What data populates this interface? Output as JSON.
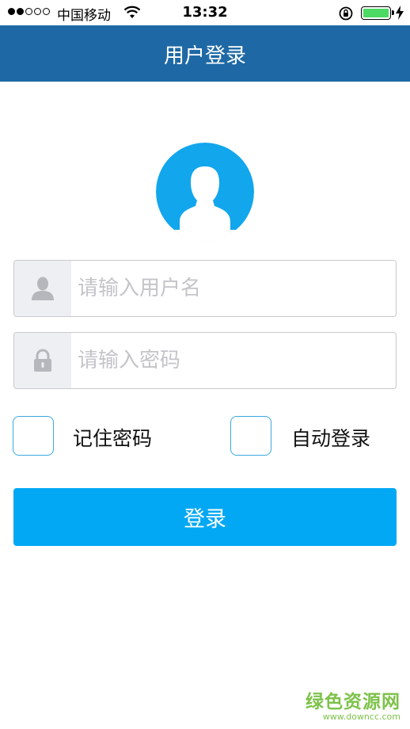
{
  "status_bar": {
    "carrier": "中国移动",
    "time": "13:32",
    "signal_bars_filled": 2,
    "signal_bars_total": 5,
    "battery_level": 1.0,
    "battery_color": "#4cd964"
  },
  "nav": {
    "title": "用户登录",
    "background_color": "#1e69a5"
  },
  "avatar": {
    "icon": "user-avatar-icon",
    "color": "#12a6ed"
  },
  "form": {
    "username": {
      "placeholder": "请输入用户名",
      "value": "",
      "icon": "user-icon"
    },
    "password": {
      "placeholder": "请输入密码",
      "value": "",
      "icon": "lock-icon"
    },
    "remember_password": {
      "label": "记住密码",
      "checked": false
    },
    "auto_login": {
      "label": "自动登录",
      "checked": false
    },
    "submit_label": "登录",
    "accent_color": "#02a8f4"
  },
  "watermark": {
    "text": "绿色资源网",
    "url": "www.downcc.com"
  }
}
